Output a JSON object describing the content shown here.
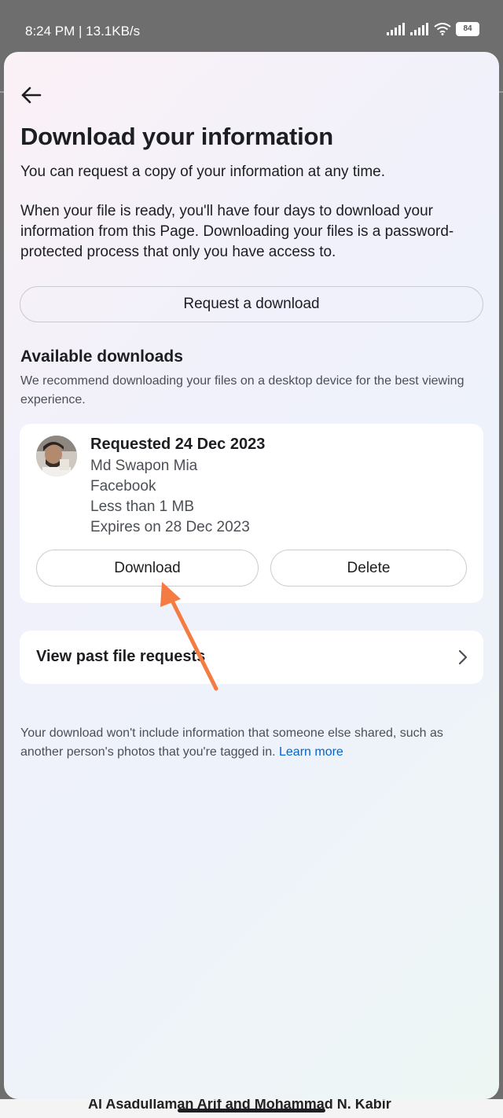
{
  "status_bar": {
    "time": "8:24 PM | 13.1KB/s",
    "battery": "84"
  },
  "header": {
    "title": "Download your information"
  },
  "intro": {
    "line1": "You can request a copy of your information at any time.",
    "line2": "When your file is ready, you'll have four days to download your information from this Page. Downloading your files is a password-protected process that only you have access to."
  },
  "request_button": "Request a download",
  "available": {
    "title": "Available downloads",
    "subtitle": "We recommend downloading your files on a desktop device for the best viewing experience.",
    "item": {
      "requested": "Requested 24 Dec 2023",
      "name": "Md Swapon Mia",
      "platform": "Facebook",
      "size": "Less than 1 MB",
      "expires": "Expires on 28 Dec 2023",
      "download_label": "Download",
      "delete_label": "Delete"
    }
  },
  "past_requests": {
    "label": "View past file requests"
  },
  "footnote": {
    "text": "Your download won't include information that someone else shared, such as another person's photos that you're tagged in. ",
    "link": "Learn more"
  },
  "background_peek": {
    "text": "Al Asadullaman Arif and Mohammad N. Kabir"
  },
  "colors": {
    "annotation_arrow": "#f47b42",
    "link": "#0064d1"
  },
  "icons": [
    "back-arrow-icon",
    "chevron-right-icon",
    "signal-icon",
    "wifi-icon",
    "battery-icon"
  ]
}
